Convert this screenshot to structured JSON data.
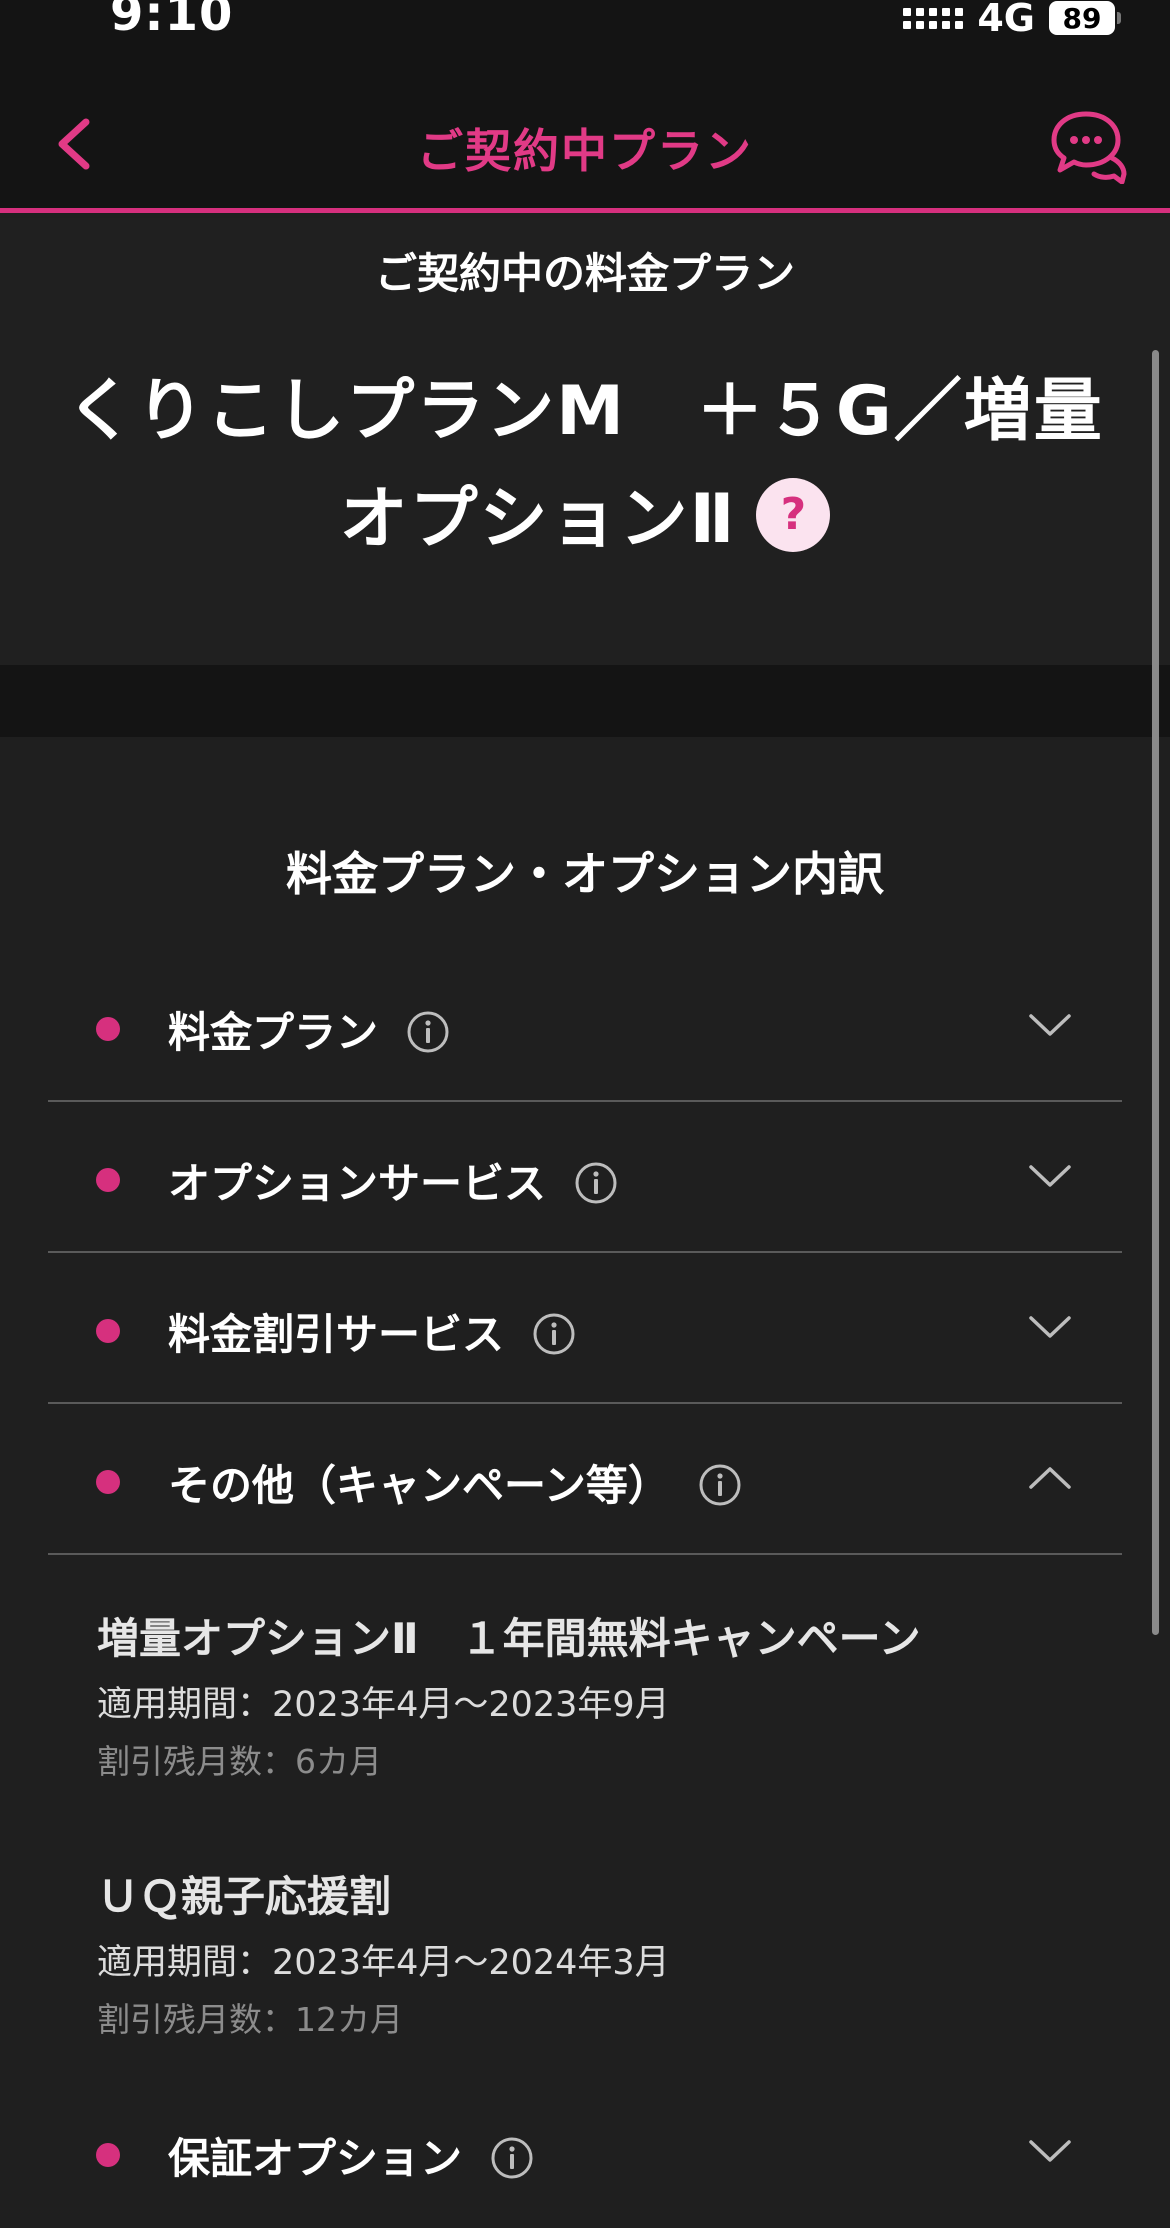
{
  "status_bar": {
    "time": "9:10",
    "network": "4G",
    "battery": "89"
  },
  "header": {
    "title": "ご契約中プラン",
    "back_icon": "chevron-left-icon",
    "chat_icon": "chat-bubbles-icon",
    "accent_color": "#d6307e"
  },
  "plan": {
    "label": "ご契約中の料金プラン",
    "name": "くりこしプランM　＋５G／増量オプションⅡ",
    "help_symbol": "?"
  },
  "breakdown": {
    "title": "料金プラン・オプション内訳",
    "sections": [
      {
        "label": "料金プラン",
        "expanded": false
      },
      {
        "label": "オプションサービス",
        "expanded": false
      },
      {
        "label": "料金割引サービス",
        "expanded": false
      },
      {
        "label": "その他（キャンペーン等）",
        "expanded": true
      },
      {
        "label": "保証オプション",
        "expanded": false
      }
    ],
    "campaigns": [
      {
        "title": "増量オプションⅡ　１年間無料キャンペーン",
        "period": "適用期間：2023年4月～2023年9月",
        "remaining": "割引残月数：6カ月"
      },
      {
        "title": "ＵＱ親子応援割",
        "period": "適用期間：2023年4月～2024年3月",
        "remaining": "割引残月数：12カ月"
      }
    ]
  }
}
